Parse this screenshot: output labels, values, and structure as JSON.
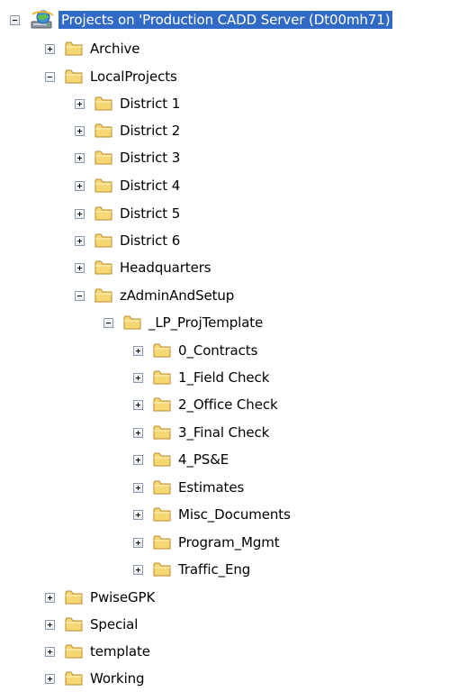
{
  "tree": {
    "root": {
      "label": "Projects on 'Production CADD Server (Dt00mh71)",
      "icon": "server-globe-icon",
      "selected_bg": "#316ac5"
    },
    "items": [
      {
        "label": "Archive",
        "state": "collapsed",
        "icon": "folder-icon"
      },
      {
        "label": "LocalProjects",
        "state": "expanded",
        "icon": "folder-icon"
      },
      {
        "label": "District 1",
        "state": "collapsed",
        "icon": "folder-icon"
      },
      {
        "label": "District 2",
        "state": "collapsed",
        "icon": "folder-icon"
      },
      {
        "label": "District 3",
        "state": "collapsed",
        "icon": "folder-icon"
      },
      {
        "label": "District 4",
        "state": "collapsed",
        "icon": "folder-icon"
      },
      {
        "label": "District 5",
        "state": "collapsed",
        "icon": "folder-icon"
      },
      {
        "label": "District 6",
        "state": "collapsed",
        "icon": "folder-icon"
      },
      {
        "label": "Headquarters",
        "state": "collapsed",
        "icon": "folder-icon"
      },
      {
        "label": "zAdminAndSetup",
        "state": "expanded",
        "icon": "folder-icon"
      },
      {
        "label": "_LP_ProjTemplate",
        "state": "expanded",
        "icon": "folder-icon"
      },
      {
        "label": "0_Contracts",
        "state": "collapsed",
        "icon": "folder-icon"
      },
      {
        "label": "1_Field Check",
        "state": "collapsed",
        "icon": "folder-icon"
      },
      {
        "label": "2_Office Check",
        "state": "collapsed",
        "icon": "folder-icon"
      },
      {
        "label": "3_Final Check",
        "state": "collapsed",
        "icon": "folder-icon"
      },
      {
        "label": "4_PS&E",
        "state": "collapsed",
        "icon": "folder-icon"
      },
      {
        "label": "Estimates",
        "state": "collapsed",
        "icon": "folder-icon"
      },
      {
        "label": "Misc_Documents",
        "state": "collapsed",
        "icon": "folder-icon"
      },
      {
        "label": "Program_Mgmt",
        "state": "collapsed",
        "icon": "folder-icon"
      },
      {
        "label": "Traffic_Eng",
        "state": "collapsed",
        "icon": "folder-icon"
      },
      {
        "label": "PwiseGPK",
        "state": "collapsed",
        "icon": "folder-icon"
      },
      {
        "label": "Special",
        "state": "collapsed",
        "icon": "folder-icon"
      },
      {
        "label": "template",
        "state": "collapsed",
        "icon": "folder-icon"
      },
      {
        "label": "Working",
        "state": "collapsed",
        "icon": "folder-icon"
      }
    ]
  }
}
